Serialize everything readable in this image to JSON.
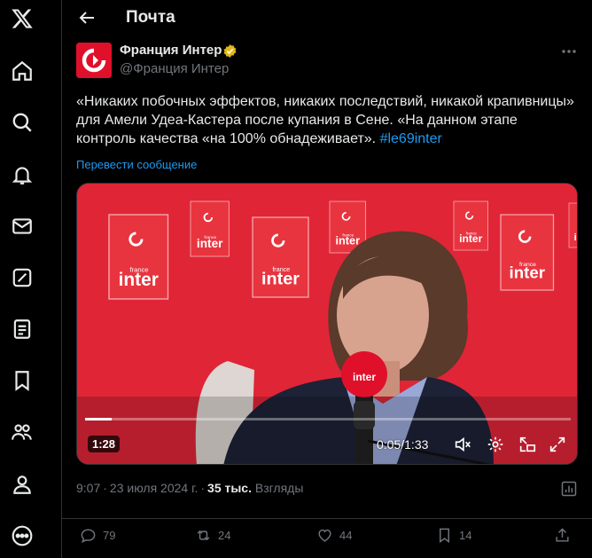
{
  "header": {
    "title": "Почта"
  },
  "sidebar": {
    "items": [
      {
        "icon": "x-logo-icon"
      },
      {
        "icon": "home-icon"
      },
      {
        "icon": "search-icon"
      },
      {
        "icon": "notifications-bell-icon"
      },
      {
        "icon": "messages-envelope-icon"
      },
      {
        "icon": "grok-icon"
      },
      {
        "icon": "lists-icon"
      },
      {
        "icon": "bookmarks-icon"
      },
      {
        "icon": "communities-icon"
      },
      {
        "icon": "profile-icon"
      },
      {
        "icon": "more-circle-icon"
      }
    ]
  },
  "tweet": {
    "author_name": "Франция Интер",
    "author_handle": "@Франция Интер",
    "text": "«Никаких побочных эффектов, никаких последствий, никакой крапивницы» для Амели Удеа-Кастера после купания в Сене. «На данном этапе контроль качества «на 100% обнадеживает».",
    "hashtag": "#le69inter",
    "translate_label": "Перевести сообщение",
    "time": "9:07",
    "date": "23 июля 2024 г.",
    "views_count": "35 тыс.",
    "views_label": "Взгляды"
  },
  "video": {
    "duration_badge": "1:28",
    "current_time": "0:05",
    "total_time": "1:33",
    "progress_fraction": 0.054,
    "logo_word": "inter",
    "logo_small": "france"
  },
  "actions": {
    "replies": "79",
    "reposts": "24",
    "likes": "44",
    "bookmarks": "14"
  },
  "colors": {
    "background": "#000000",
    "accent": "#1d9bf0",
    "muted": "#71767b",
    "verified": "#e2b719",
    "brand_red": "#e0102b"
  }
}
